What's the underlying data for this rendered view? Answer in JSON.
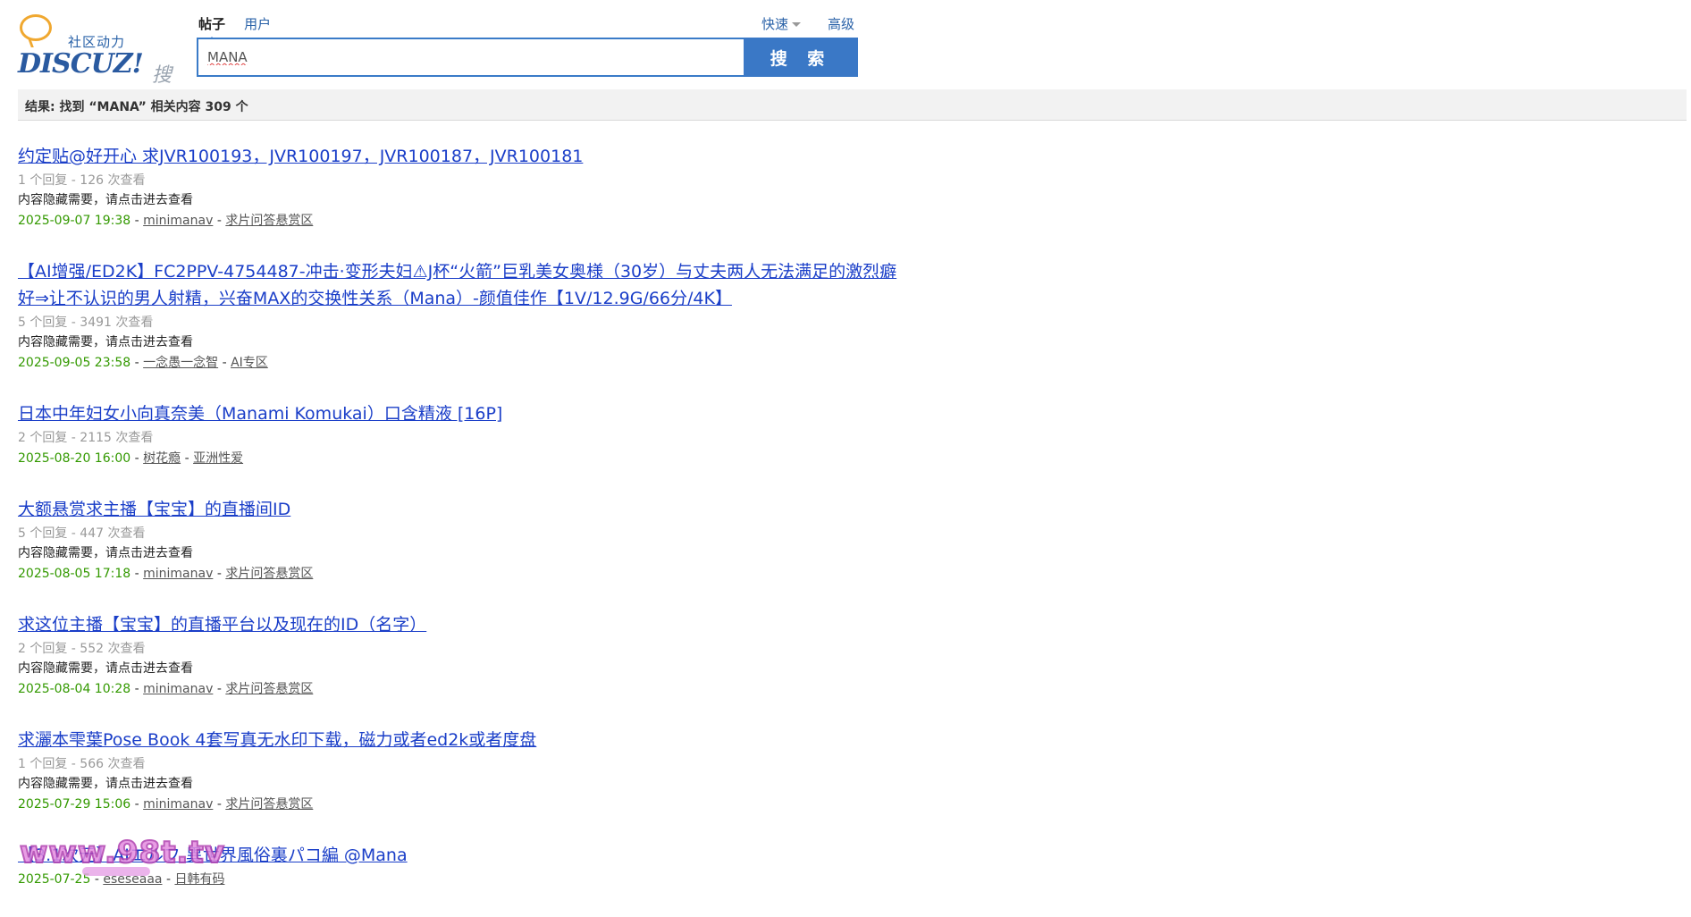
{
  "logo": {
    "tagline": "社区动力",
    "wordmark": "DISCUZ!",
    "search_word": "搜索"
  },
  "search": {
    "tabs": [
      {
        "label": "帖子",
        "active": true
      },
      {
        "label": "用户",
        "active": false
      }
    ],
    "quick_label": "快速",
    "advanced_label": "高级",
    "query": "MANA",
    "button_label": "搜 索"
  },
  "results_summary": "结果: 找到 “MANA” 相关内容 309 个",
  "results": [
    {
      "title": "约定贴@好开心 求JVR100193，JVR100197，JVR100187，JVR100181",
      "meta": "1 个回复 - 126 次查看",
      "summary": "内容隐藏需要，请点击进去查看",
      "date": "2025-09-07 19:38",
      "author": "minimanav",
      "forum": "求片问答悬赏区"
    },
    {
      "title": "【AI增强/ED2K】FC2PPV-4754487-冲击·变形夫妇⚠J杯“火箭”巨乳美女奥様（30岁）与丈夫两人无法满足的激烈癖好⇒让不认识的男人射精，兴奋MAX的交换性关系（Mana）-颜值佳作【1V/12.9G/66分/4K】",
      "meta": "5 个回复 - 3491 次查看",
      "summary": "内容隐藏需要，请点击进去查看",
      "date": "2025-09-05 23:58",
      "author": "一念愚一念智",
      "forum": "AI专区"
    },
    {
      "title": "日本中年妇女小向真奈美（Manami Komukai）口含精液 [16P]",
      "meta": "2 个回复 - 2115 次查看",
      "summary": "",
      "date": "2025-08-20 16:00",
      "author": "树花瘾",
      "forum": "亚洲性爱"
    },
    {
      "title": "大额悬赏求主播【宝宝】的直播间ID",
      "meta": "5 个回复 - 447 次查看",
      "summary": "内容隐藏需要，请点击进去查看",
      "date": "2025-08-05 17:18",
      "author": "minimanav",
      "forum": "求片问答悬赏区"
    },
    {
      "title": "求这位主播【宝宝】的直播平台以及现在的ID（名字）",
      "meta": "2 个回复 - 552 次查看",
      "summary": "内容隐藏需要，请点击进去查看",
      "date": "2025-08-04 10:28",
      "author": "minimanav",
      "forum": "求片问答悬赏区"
    },
    {
      "title": "求灑本雫葉Pose Book 4套写真无水印下载，磁力或者ed2k或者度盘",
      "meta": "1 个回复 - 566 次查看",
      "summary": "内容隐藏需要，请点击进去查看",
      "date": "2025-07-29 15:06",
      "author": "minimanav",
      "forum": "求片问答悬赏区"
    },
    {
      "title": "【3.1次元】AIエルフ 異世界風俗裏パコ編 @Mana",
      "meta": "",
      "summary": "",
      "date": "2025-07-25",
      "author": "eseseaaa",
      "forum": "日韩有码"
    }
  ],
  "watermark": "www.98t.tv",
  "colors": {
    "link": "#1a3ec8",
    "date": "#339900",
    "accent": "#3a78c6",
    "meta": "#999999"
  }
}
